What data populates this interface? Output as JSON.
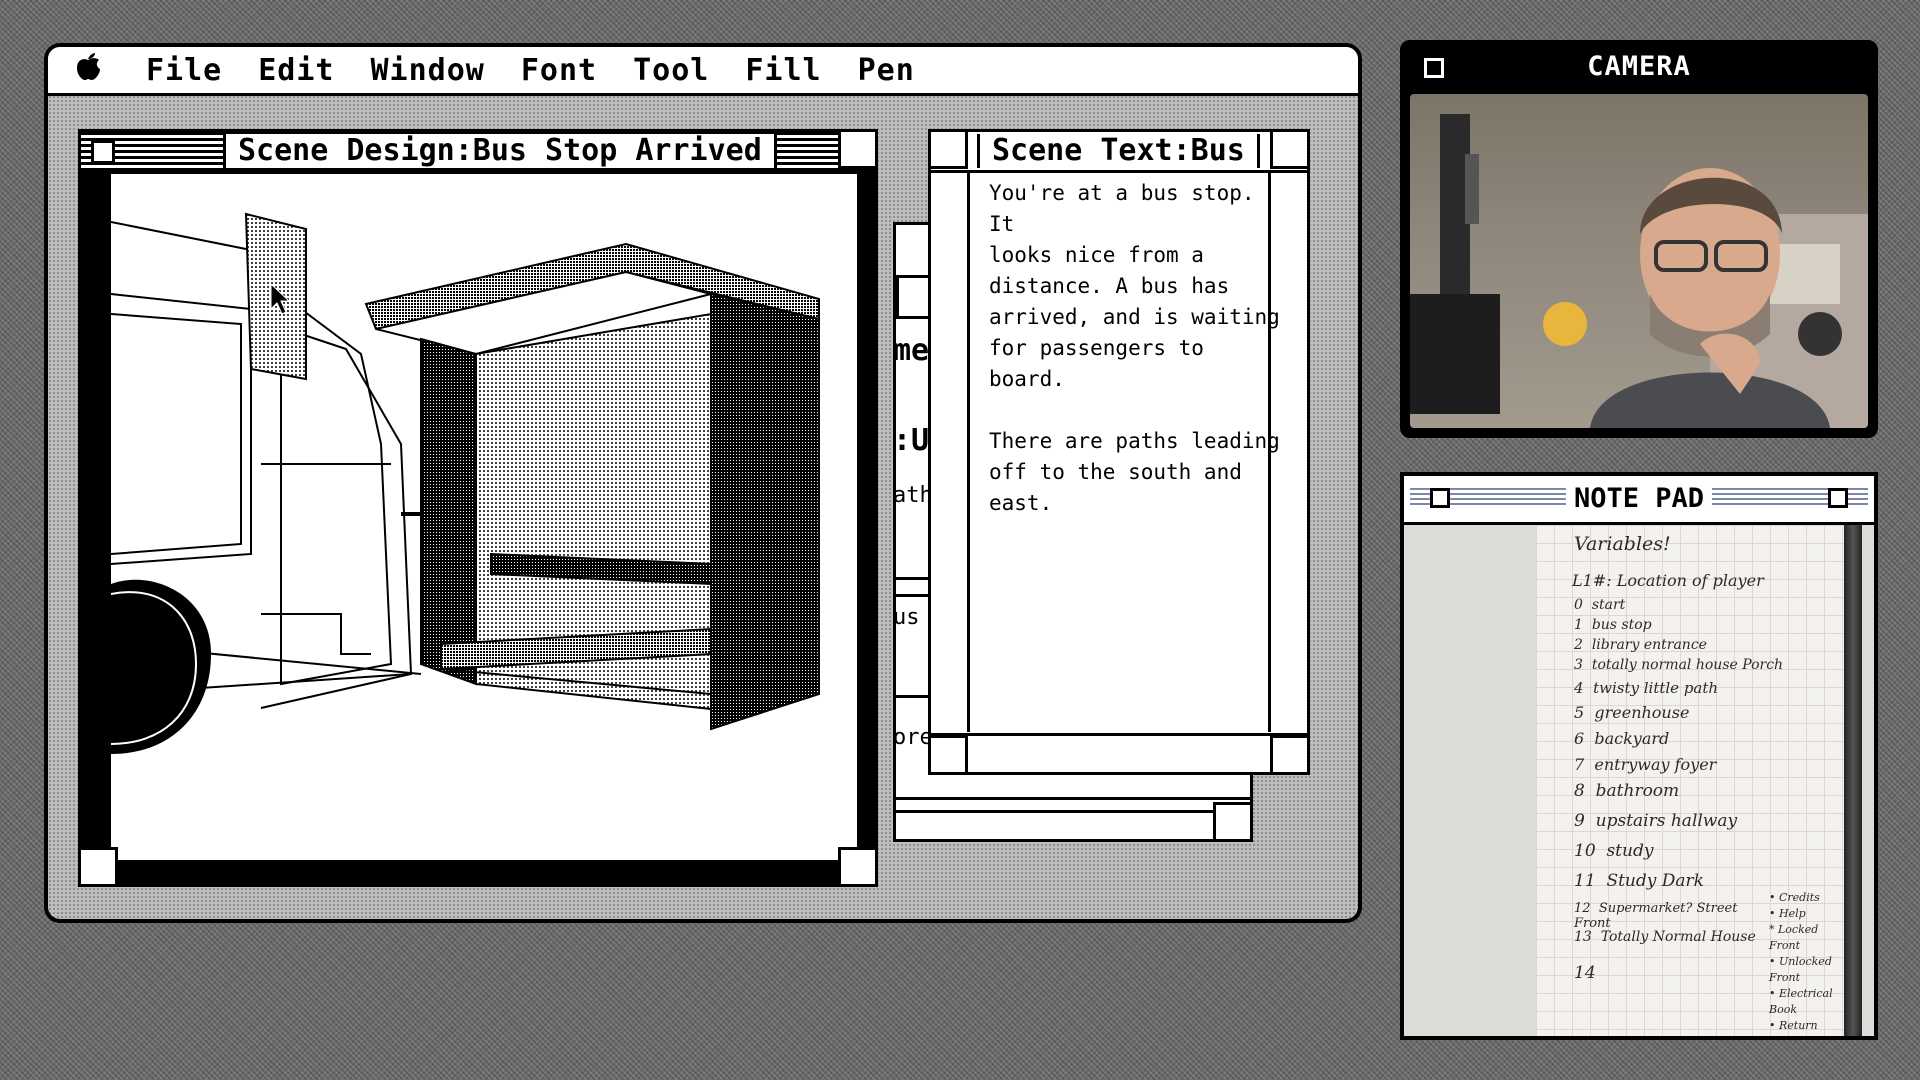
{
  "menubar": {
    "apple_label": "",
    "items": [
      "File",
      "Edit",
      "Window",
      "Font",
      "Tool",
      "Fill",
      "Pen"
    ]
  },
  "scene_design": {
    "title": "Scene Design:Bus Stop Arrived"
  },
  "scene_text": {
    "title": "Scene Text:Bus",
    "body": "You're at a bus stop. It\nlooks nice from a\ndistance. A bus has\narrived, and is waiting\nfor passengers to board.\n\nThere are paths leading\noff to the south and east."
  },
  "background_window_fragments": [
    "me",
    ":U",
    "ath",
    "us",
    "ore"
  ],
  "camera": {
    "title": "CAMERA"
  },
  "notepad": {
    "title": "NOTE PAD",
    "heading": "Variables!",
    "var_label": "L1#: Location of player",
    "locations": [
      {
        "n": "0",
        "name": "start"
      },
      {
        "n": "1",
        "name": "bus stop"
      },
      {
        "n": "2",
        "name": "library entrance"
      },
      {
        "n": "3",
        "name": "totally normal house Porch"
      },
      {
        "n": "4",
        "name": "twisty little path"
      },
      {
        "n": "5",
        "name": "greenhouse"
      },
      {
        "n": "6",
        "name": "backyard"
      },
      {
        "n": "7",
        "name": "entryway foyer"
      },
      {
        "n": "8",
        "name": "bathroom"
      },
      {
        "n": "9",
        "name": "upstairs hallway"
      },
      {
        "n": "10",
        "name": "study"
      },
      {
        "n": "11",
        "name": "Study Dark"
      },
      {
        "n": "12",
        "name": "Supermarket? Street Front"
      },
      {
        "n": "13",
        "name": "Totally Normal House"
      },
      {
        "n": "14",
        "name": ""
      }
    ],
    "side_notes": [
      "• Credits",
      "• Help",
      "* Locked Front",
      "• Unlocked Front",
      "• Electrical Book",
      "• Return"
    ]
  }
}
